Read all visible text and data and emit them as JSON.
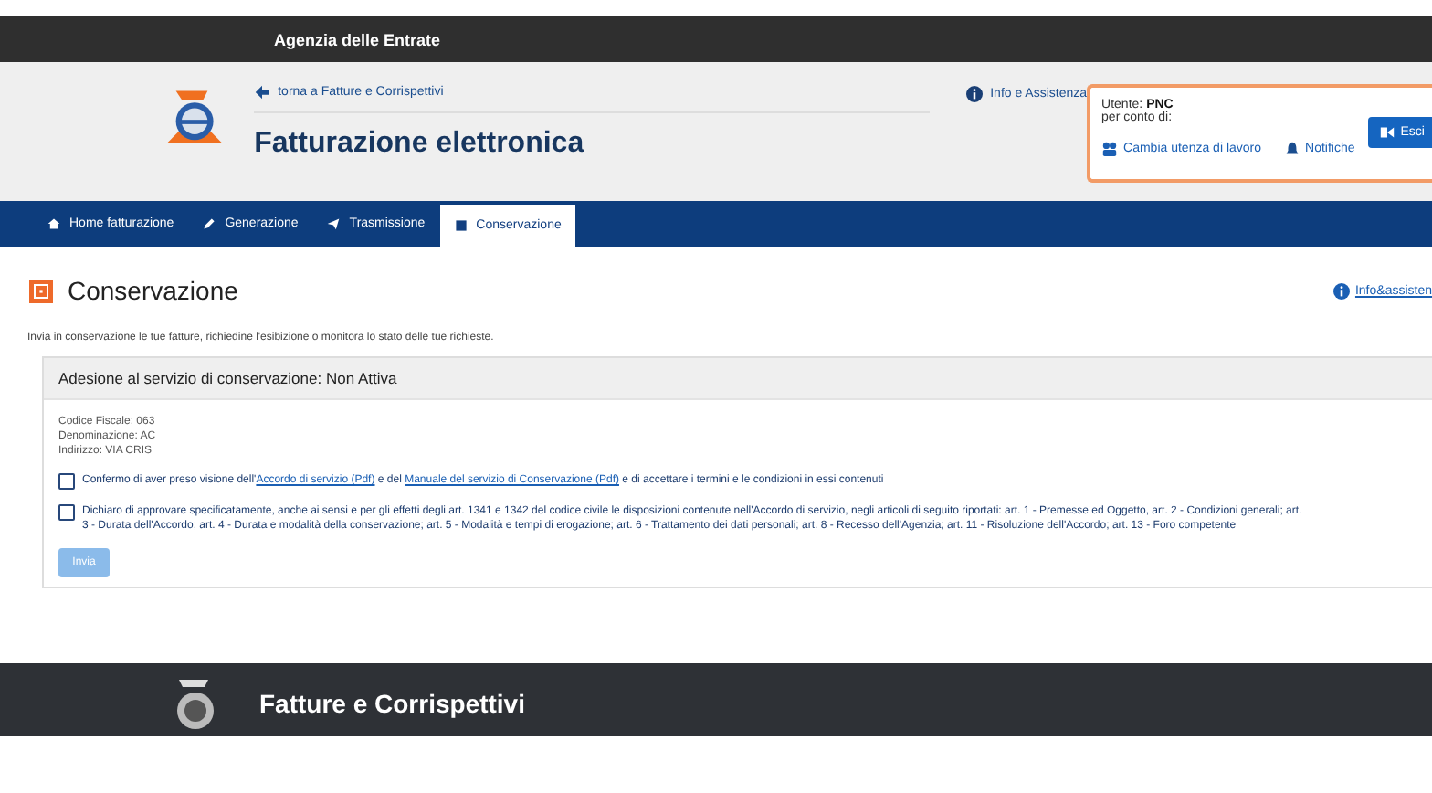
{
  "top_bar": {
    "title": "Agenzia delle Entrate"
  },
  "header": {
    "back_link": "torna a Fatture e Corrispettivi",
    "title": "Fatturazione elettronica",
    "help_link": "Info e Assistenza",
    "user_box": {
      "user_label": "Utente:",
      "user": "PNC",
      "on_behalf": "per conto di:",
      "change_link": "Cambia utenza di lavoro",
      "notifications_link": "Notifiche",
      "logout_button": "Esci"
    }
  },
  "tabs": [
    {
      "label": "Home fatturazione",
      "selected": false
    },
    {
      "label": "Generazione",
      "selected": false
    },
    {
      "label": "Trasmissione",
      "selected": false
    },
    {
      "label": "Conservazione",
      "selected": true
    }
  ],
  "page": {
    "title": "Conservazione",
    "help_link": "Info&assisten",
    "intro": "Invia in conservazione le tue fatture, richiedine l'esibizione o monitora lo stato delle tue richieste.",
    "panel": {
      "title": "Adesione al servizio di conservazione: Non Attiva",
      "details": [
        "Codice Fiscale: 063",
        "Denominazione: AC",
        "Indirizzo: VIA CRIS"
      ],
      "agreements": [
        {
          "checked": false,
          "parts": [
            {
              "text": "Confermo di aver preso visione dell'",
              "link": false
            },
            {
              "text": "Accordo di servizio (Pdf)",
              "link": true
            },
            {
              "text": " e del ",
              "link": false
            },
            {
              "text": "Manuale del servizio di Conservazione (Pdf)",
              "link": true
            },
            {
              "text": " e di accettare i termini e le condizioni in essi contenuti",
              "link": false
            }
          ]
        },
        {
          "checked": false,
          "parts": [
            {
              "text": "Dichiaro di approvare specificatamente, anche ai sensi e per gli effetti degli art. 1341 e 1342 del codice civile le disposizioni contenute nell'Accordo di servizio, negli articoli di seguito riportati: art. 1 - Premesse ed Oggetto, art. 2 - Condizioni generali; art. 3 - Durata dell'Accordo; art. 4 - Durata e modalità della conservazione; art. 5 - Modalità e tempi di erogazione; art. 6 - Trattamento dei dati personali; art. 8 - Recesso dell'Agenzia; art. 11 - Risoluzione dell'Accordo; art. 13 - Foro competente",
              "link": false
            }
          ]
        }
      ],
      "submit": {
        "label": "Invia",
        "disabled": true
      }
    }
  },
  "footer": {
    "title": "Fatture e Corrispettivi"
  }
}
